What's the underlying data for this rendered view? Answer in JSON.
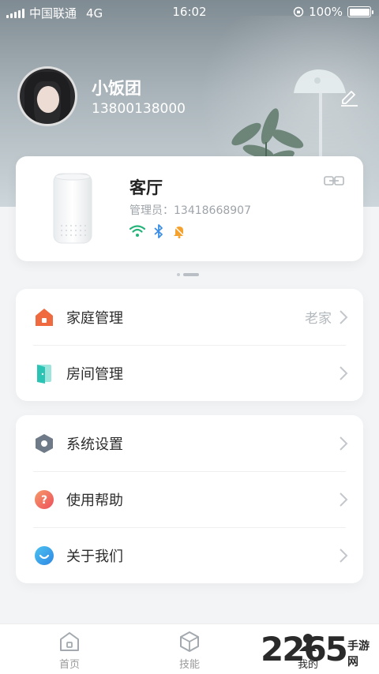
{
  "status_bar": {
    "carrier": "中国联通",
    "network": "4G",
    "time": "16:02",
    "battery": "100%"
  },
  "profile": {
    "name": "小饭团",
    "phone": "13800138000"
  },
  "device": {
    "room": "客厅",
    "admin": "管理员：13418668907",
    "icons": [
      "wifi-icon",
      "bluetooth-icon",
      "bell-icon"
    ]
  },
  "menu_group_1": [
    {
      "label": "家庭管理",
      "value": "老家",
      "icon": "home-icon",
      "color": "#f06a3f"
    },
    {
      "label": "房间管理",
      "value": "",
      "icon": "door-icon",
      "color": "#2bc4b4"
    }
  ],
  "menu_group_2": [
    {
      "label": "系统设置",
      "icon": "settings-icon",
      "color": "#6f7a88"
    },
    {
      "label": "使用帮助",
      "icon": "help-icon",
      "color": "#f26b5b"
    },
    {
      "label": "关于我们",
      "icon": "about-icon",
      "color": "#3aa0ea"
    }
  ],
  "tabs": [
    {
      "label": "首页",
      "icon": "home-tab-icon"
    },
    {
      "label": "技能",
      "icon": "skills-tab-icon"
    },
    {
      "label": "我的",
      "icon": "profile-tab-icon"
    }
  ],
  "watermark": {
    "number": "2265",
    "text": "手游网"
  },
  "colors": {
    "accent_green": "#25b37a",
    "accent_blue": "#3a8ee6",
    "accent_orange": "#f4a12e"
  }
}
